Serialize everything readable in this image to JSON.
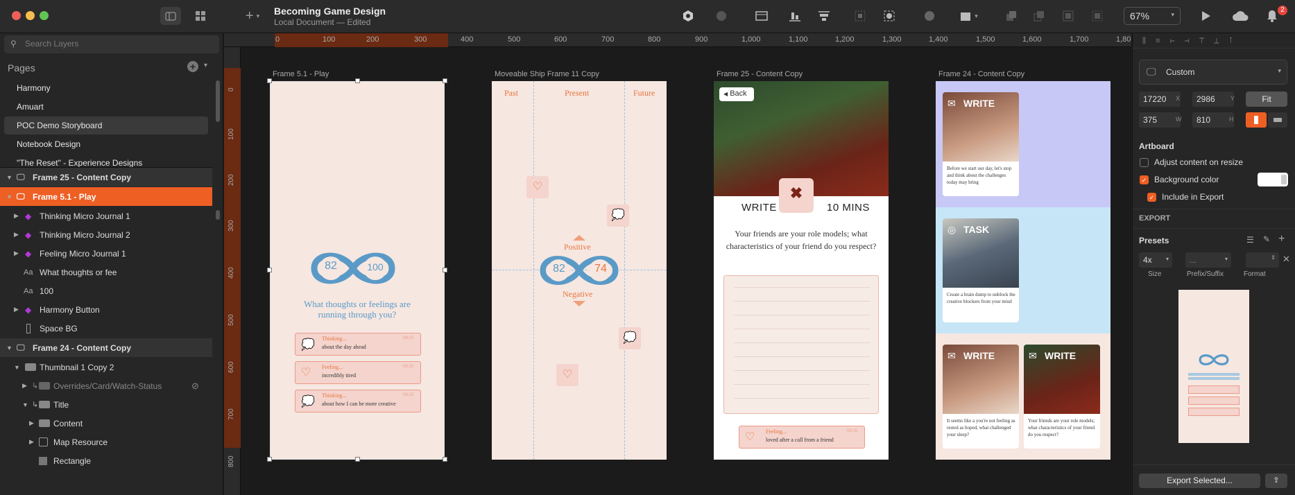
{
  "window": {
    "doc_title": "Becoming Game Design",
    "doc_subtitle": "Local Document — Edited",
    "zoom": "67%",
    "notifications": "2"
  },
  "toolbar_icons": [
    "sidebar-toggle-icon",
    "components-grid-icon",
    "insert-plus-icon",
    "symbol-icon",
    "mask-icon",
    "frame-icon",
    "align-icon",
    "distribute-icon",
    "scale-icon",
    "flatten-icon",
    "boolean-icon",
    "edit-shape-icon",
    "layer-order-icons",
    "play-icon",
    "cloud-icon",
    "bell-icon"
  ],
  "sidebar": {
    "search_placeholder": "Search Layers",
    "pages_header": "Pages",
    "pages": [
      "Harmony",
      "Amuart",
      "POC Demo Storyboard",
      "Notebook Design",
      "\"The Reset\" - Experience Designs"
    ],
    "selected_page": "POC Demo Storyboard",
    "layers": [
      {
        "label": "Frame 25 - Content Copy",
        "kind": "frame"
      },
      {
        "label": "Frame 5.1 - Play",
        "kind": "frame-active"
      },
      {
        "label": "Thinking Micro Journal 1",
        "kind": "symbol"
      },
      {
        "label": "Thinking Micro Journal 2",
        "kind": "symbol"
      },
      {
        "label": "Feeling Micro Journal 1",
        "kind": "symbol"
      },
      {
        "label": "What thoughts or fee",
        "kind": "text"
      },
      {
        "label": "100",
        "kind": "text"
      },
      {
        "label": "Harmony Button",
        "kind": "symbol"
      },
      {
        "label": "Space BG",
        "kind": "rect"
      },
      {
        "label": "Frame 24 - Content Copy",
        "kind": "frame"
      },
      {
        "label": "Thumbnail 1 Copy 2",
        "kind": "group"
      },
      {
        "label": "Overrides/Card/Watch-Status",
        "kind": "group-hidden"
      },
      {
        "label": "Title",
        "kind": "group"
      },
      {
        "label": "Content",
        "kind": "folder"
      },
      {
        "label": "Map Resource",
        "kind": "symbol-inst"
      },
      {
        "label": "Rectangle",
        "kind": "rect"
      }
    ]
  },
  "ruler": {
    "top": [
      "0",
      "100",
      "200",
      "300",
      "400",
      "500",
      "600",
      "700",
      "800",
      "900",
      "1,000",
      "1,100",
      "1,200",
      "1,300",
      "1,400",
      "1,500",
      "1,600",
      "1,700",
      "1,80"
    ],
    "left": [
      "0",
      "100",
      "200",
      "300",
      "400",
      "500",
      "600",
      "700",
      "800"
    ]
  },
  "artboards": {
    "play": {
      "label": "Frame 5.1 - Play",
      "score_left": "82",
      "score_right": "100",
      "question": "What thoughts or feelings are running through you?",
      "cards": [
        {
          "title": "Thinking...",
          "text": "about the day ahead",
          "time": "09:15"
        },
        {
          "title": "Feeling...",
          "text": "incredibly tired",
          "time": "09:15"
        },
        {
          "title": "Thinking...",
          "text": "about how I can be more creative",
          "time": "09:15"
        }
      ]
    },
    "ship": {
      "label": "Moveable Ship Frame 11 Copy",
      "past": "Past",
      "present": "Present",
      "future": "Future",
      "positive": "Positive",
      "negative": "Negative",
      "score_left": "82",
      "score_right": "74"
    },
    "content25": {
      "label": "Frame 25 - Content Copy",
      "back": "Back",
      "write": "WRITE",
      "duration": "10 MINS",
      "prompt": "Your friends are your role models; what characteristics of your friend do you respect?",
      "card_title": "Feeling...",
      "card_text": "loved after a call from a friend",
      "card_time": "09:15"
    },
    "content24": {
      "label": "Frame 24 - Content Copy",
      "tiles": [
        {
          "title": "WRITE",
          "text": "Before we start our day, let's stop and think about the challenges today may bring"
        },
        {
          "title": "TASK",
          "text": "Create a brain dump to unblock the creative blockers from your mind"
        },
        {
          "title": "WRITE",
          "text": "It seems like a you're not feeling as rested as hoped, what challenged your sleep?"
        },
        {
          "title": "WRITE",
          "text": "Your friends are your role models; what characteristics of your friend do you respect?"
        }
      ]
    }
  },
  "inspector": {
    "preset": "Custom",
    "x": "17220",
    "x_label": "X",
    "y": "2986",
    "y_label": "Y",
    "w": "375",
    "w_label": "W",
    "h": "810",
    "h_label": "H",
    "fit": "Fit",
    "artboard_header": "Artboard",
    "adjust_label": "Adjust content on resize",
    "adjust_checked": false,
    "bg_label": "Background color",
    "bg_checked": true,
    "include_label": "Include in Export",
    "include_checked": true,
    "export_header": "EXPORT",
    "presets_header": "Presets",
    "size_value": "4x",
    "prefix_value": "...",
    "size_label": "Size",
    "prefix_label": "Prefix/Suffix",
    "format_label": "Format",
    "export_button": "Export Selected..."
  },
  "colors": {
    "accent": "#ee5f24",
    "artboard_bg": "#f6e7e1",
    "infinity_blue": "#5a9ac7",
    "journal_orange": "#e8753e"
  }
}
